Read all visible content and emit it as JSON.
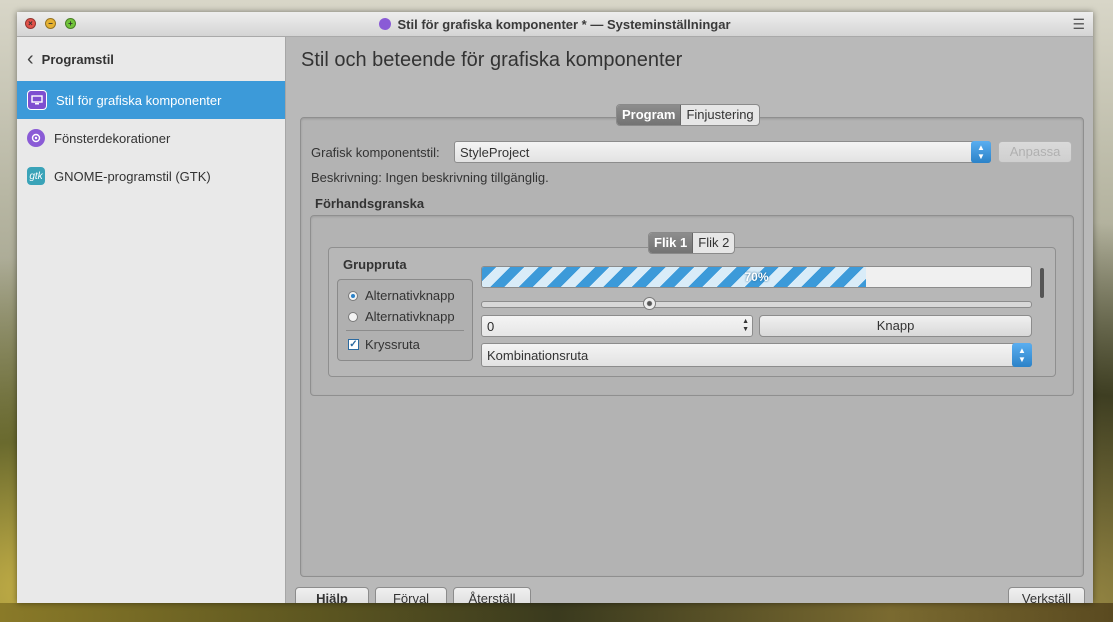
{
  "window": {
    "title": "Stil för grafiska komponenter * — Systeminställningar",
    "close_glyph": "×",
    "min_glyph": "−",
    "max_glyph": "+",
    "menu_glyph": "☰"
  },
  "sidebar": {
    "back_label": "Programstil",
    "back_glyph": "‹",
    "items": [
      {
        "label": "Stil för grafiska komponenter",
        "icon": "monitor-icon",
        "active": true
      },
      {
        "label": "Fönsterdekorationer",
        "icon": "gear-icon",
        "active": false
      },
      {
        "label": "GNOME-programstil (GTK)",
        "icon": "gtk-icon",
        "icon_text": "gtk",
        "active": false
      }
    ]
  },
  "main": {
    "title": "Stil och beteende för grafiska komponenter",
    "tabs": [
      {
        "label": "Program",
        "selected": true
      },
      {
        "label": "Finjustering",
        "selected": false
      }
    ],
    "style_label": "Grafisk komponentstil:",
    "style_value": "StyleProject",
    "adjust_button": "Anpassa",
    "description": "Beskrivning: Ingen beskrivning tillgänglig.",
    "preview_heading": "Förhandsgranska",
    "preview": {
      "tabs": [
        {
          "label": "Flik 1",
          "selected": true
        },
        {
          "label": "Flik 2",
          "selected": false
        }
      ],
      "groupbox_title": "Gruppruta",
      "radio1": "Alternativknapp",
      "radio2": "Alternativknapp",
      "checkbox": "Kryssruta",
      "progress_value": 70,
      "progress_text": "70%",
      "slider_value": 0.3,
      "spin_value": "0",
      "button": "Knapp",
      "combo": "Kombinationsruta"
    }
  },
  "footer": {
    "help": "Hjälp",
    "defaults": "Förval",
    "reset": "Återställ",
    "apply": "Verkställ"
  },
  "colors": {
    "accent": "#3c9ad9",
    "panel": "#b9b9b9",
    "sidebar": "#e9e9e9"
  }
}
